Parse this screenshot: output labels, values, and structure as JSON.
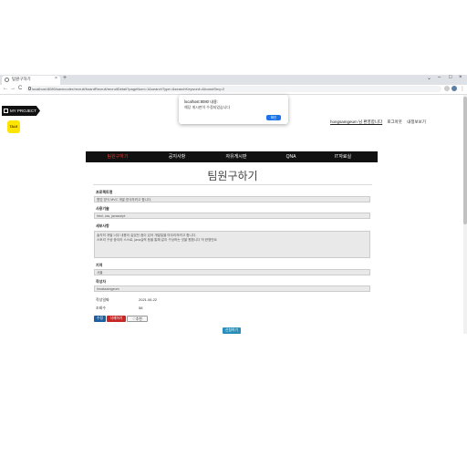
{
  "browser": {
    "tab_title": "팀원구하기",
    "new_tab_symbol": "+",
    "tab_close_symbol": "×",
    "window_controls": [
      "⌄",
      "–",
      "□",
      "×"
    ],
    "nav": {
      "back": "←",
      "forward": "→",
      "reload": "C"
    },
    "url": "localhost:8080/savecoder/recruit/boardRecruit/recruitDetail?pageNum=1&searchType=&searchKeyword=&boardSeq=2"
  },
  "sidebar": {
    "project_label": "MY PROJECT",
    "kakao_label": "TALK"
  },
  "top_links": {
    "user": "hongsamgeum 님 환영합니다",
    "logout": "로그아웃",
    "mypage": "내정보보기"
  },
  "navbar": {
    "items": [
      "팀원구하기",
      "공지사항",
      "자유게시판",
      "QNA",
      "IT자료실"
    ]
  },
  "page": {
    "title": "팀원구하기",
    "project_name_label": "프로젝트명",
    "project_name_value": "협업 방식 MVC 개발 방식하려고 합니다.",
    "tech_label": "사용기술",
    "tech_value": "html, css, javascript",
    "detail_label": "세부사항",
    "detail_value_line1": "솔직히 개발 너무 내용이 길었던 점이 있어 개발일을 마무리하려고 합니다.",
    "detail_value_line2": "스토리 구상 중이라 스스로, java실력 등을 통해 같이 구상하는 것을 원합니다 딱 한명만요",
    "region_label": "지역",
    "region_value": "서울",
    "writer_label": "작성자",
    "writer_value": "hmaksamgeum",
    "date_label": "작성일짜",
    "date_value": "2021.06.22",
    "views_label": "조회수",
    "views_value": "58"
  },
  "buttons": {
    "edit": "수정",
    "delete": "삭제하기",
    "like": "♡추천",
    "apply": "신청하기"
  },
  "dialog": {
    "title": "localhost:8080 내용:",
    "message": "해당 게시판이 수정되었습니다",
    "ok": "확인"
  },
  "colors": {
    "navbar_bg": "#111111",
    "active_nav": "#e53935",
    "edit_btn": "#1f5f9f",
    "delete_btn": "#c62828",
    "apply_btn": "#2a8fb8",
    "dialog_ok": "#1a73e8",
    "kakao": "#fee500"
  }
}
